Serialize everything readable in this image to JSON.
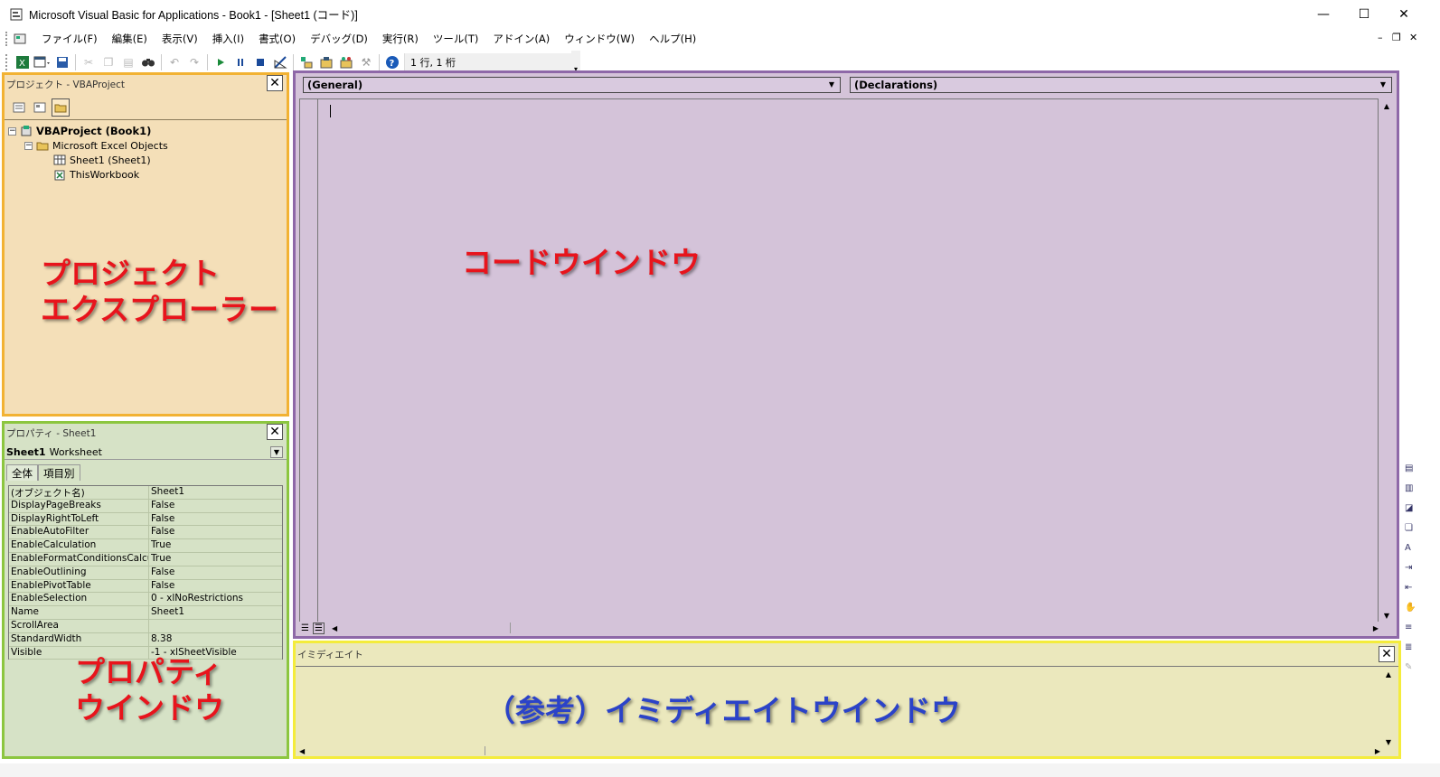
{
  "window": {
    "title": "Microsoft Visual Basic for Applications - Book1 - [Sheet1 (コード)]",
    "controls": {
      "minimize": "—",
      "maximize": "☐",
      "close": "✕"
    }
  },
  "menu": {
    "items": [
      "ファイル(F)",
      "編集(E)",
      "表示(V)",
      "挿入(I)",
      "書式(O)",
      "デバッグ(D)",
      "実行(R)",
      "ツール(T)",
      "アドイン(A)",
      "ウィンドウ(W)",
      "ヘルプ(H)"
    ],
    "mdi_controls": {
      "minimize": "–",
      "restore": "❐",
      "close": "✕"
    }
  },
  "toolbar": {
    "icons": [
      "excel-icon",
      "insert-userform-icon",
      "save-icon",
      "cut-icon",
      "copy-icon",
      "paste-icon",
      "find-icon",
      "undo-icon",
      "redo-icon",
      "run-icon",
      "break-icon",
      "reset-icon",
      "design-mode-icon",
      "project-explorer-icon",
      "properties-icon",
      "object-browser-icon",
      "toolbox-icon",
      "help-icon"
    ],
    "position": "1 行, 1 桁"
  },
  "project_explorer": {
    "title": "プロジェクト - VBAProject",
    "tree": {
      "root": "VBAProject (Book1)",
      "folder": "Microsoft Excel Objects",
      "items": [
        "Sheet1 (Sheet1)",
        "ThisWorkbook"
      ]
    },
    "overlay": [
      "プロジェクト",
      "エクスプローラー"
    ]
  },
  "properties": {
    "title": "プロパティ - Sheet1",
    "object": {
      "name": "Sheet1",
      "type": "Worksheet"
    },
    "tabs": [
      "全体",
      "項目別"
    ],
    "rows": [
      [
        "(オブジェクト名)",
        "Sheet1"
      ],
      [
        "DisplayPageBreaks",
        "False"
      ],
      [
        "DisplayRightToLeft",
        "False"
      ],
      [
        "EnableAutoFilter",
        "False"
      ],
      [
        "EnableCalculation",
        "True"
      ],
      [
        "EnableFormatConditionsCalcul",
        "True"
      ],
      [
        "EnableOutlining",
        "False"
      ],
      [
        "EnablePivotTable",
        "False"
      ],
      [
        "EnableSelection",
        "0 - xlNoRestrictions"
      ],
      [
        "Name",
        "Sheet1"
      ],
      [
        "ScrollArea",
        ""
      ],
      [
        "StandardWidth",
        "8.38"
      ],
      [
        "Visible",
        "-1 - xlSheetVisible"
      ]
    ],
    "overlay": [
      "プロパティ",
      "ウインドウ"
    ]
  },
  "code_window": {
    "object_combo": "(General)",
    "procedure_combo": "(Declarations)",
    "overlay": "コードウインドウ"
  },
  "immediate": {
    "title": "イミディエイト",
    "overlay": "（参考）イミディエイトウインドウ"
  },
  "colors": {
    "project_bg": "#f4dfb8",
    "project_border": "#f2b233",
    "props_bg": "#d6e2c6",
    "props_border": "#8cc63f",
    "code_bg": "#d4c3d9",
    "code_border": "#8e68a8",
    "immed_bg": "#ebe8bd",
    "immed_border": "#f4ec3c",
    "overlay_red": "#e8141c",
    "overlay_blue": "#2b43c8"
  }
}
